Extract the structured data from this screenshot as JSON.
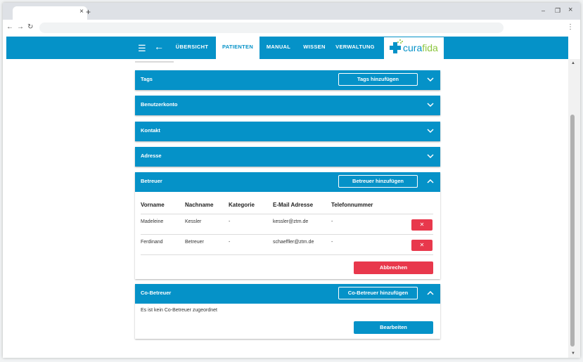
{
  "browser": {
    "tab_close": "×",
    "new_tab": "+",
    "minimize": "–",
    "restore": "❐",
    "close": "×",
    "back": "←",
    "forward": "→",
    "reload": "↻",
    "menu": "⋮"
  },
  "header": {
    "nav": [
      {
        "label": "ÜBERSICHT"
      },
      {
        "label": "PATIENTEN"
      },
      {
        "label": "MANUAL"
      },
      {
        "label": "WISSEN"
      },
      {
        "label": "VERWALTUNG"
      }
    ],
    "logo_part1": "cura",
    "logo_part2": "fida"
  },
  "panels": {
    "tags": {
      "title": "Tags",
      "button": "Tags hinzufügen"
    },
    "account": {
      "title": "Benutzerkonto"
    },
    "contact": {
      "title": "Kontakt"
    },
    "address": {
      "title": "Adresse"
    },
    "caregivers": {
      "title": "Betreuer",
      "button": "Betreuer hinzufügen",
      "columns": [
        "Vorname",
        "Nachname",
        "Kategorie",
        "E-Mail Adresse",
        "Telefonnummer"
      ],
      "rows": [
        {
          "first": "Madeleine",
          "last": "Kessler",
          "category": "-",
          "email": "kessler@ztm.de",
          "phone": "-",
          "delete": "✕"
        },
        {
          "first": "Ferdinand",
          "last": "Betreuer",
          "category": "-",
          "email": "schaeffler@ztm.de",
          "phone": "-",
          "delete": "✕"
        }
      ],
      "cancel": "Abbrechen"
    },
    "cocaregivers": {
      "title": "Co-Betreuer",
      "button": "Co-Betreuer hinzufügen",
      "empty": "Es ist kein Co-Betreuer zugeordnet",
      "edit": "Bearbeiten"
    }
  },
  "colors": {
    "primary": "#0592c8",
    "danger": "#e8384c",
    "logo_green": "#8cc63f"
  }
}
